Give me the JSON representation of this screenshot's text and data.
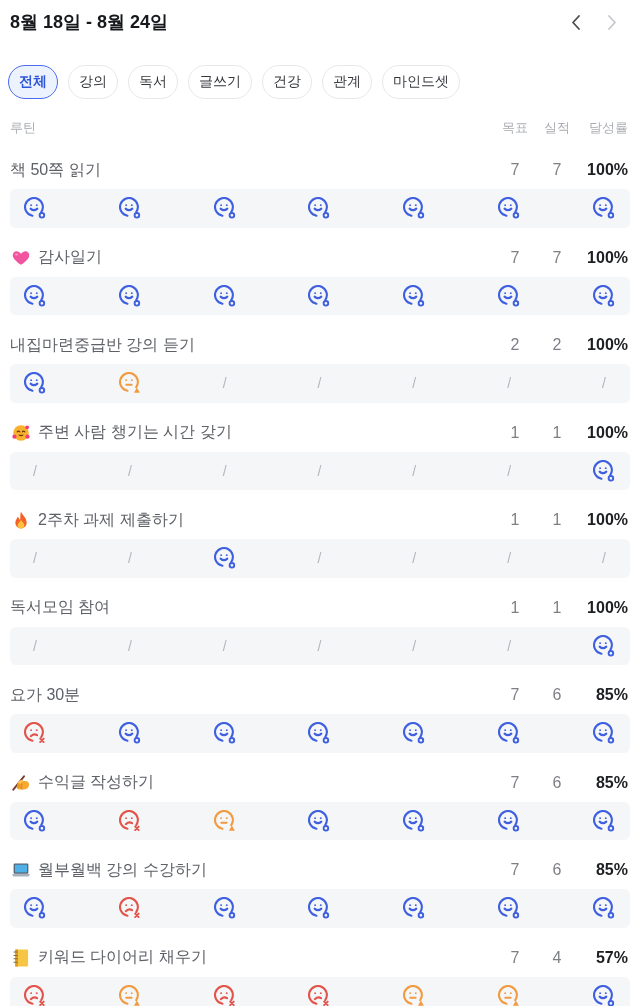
{
  "header": {
    "title": "8월 18일 - 8월 24일",
    "nav": [
      {
        "kind": "previous",
        "disabled": false
      },
      {
        "kind": "next",
        "disabled": true
      }
    ]
  },
  "tabs": [
    {
      "label": "전체",
      "selected": true
    },
    {
      "label": "강의",
      "selected": false
    },
    {
      "label": "독서",
      "selected": false
    },
    {
      "label": "글쓰기",
      "selected": false
    },
    {
      "label": "건강",
      "selected": false
    },
    {
      "label": "관계",
      "selected": false
    },
    {
      "label": "마인드셋",
      "selected": false
    }
  ],
  "columns": {
    "routine": "루틴",
    "goal": "목표",
    "actual": "실적",
    "rate": "달성률"
  },
  "routines": [
    {
      "kind": "plain",
      "title": "책 50쪽 읽기",
      "goal": "7",
      "actual": "7",
      "rate": "100%",
      "days": [
        {
          "kind": "done"
        },
        {
          "kind": "done"
        },
        {
          "kind": "done"
        },
        {
          "kind": "done"
        },
        {
          "kind": "done"
        },
        {
          "kind": "done"
        },
        {
          "kind": "done"
        }
      ]
    },
    {
      "kind": "heart",
      "title": "감사일기",
      "goal": "7",
      "actual": "7",
      "rate": "100%",
      "days": [
        {
          "kind": "done"
        },
        {
          "kind": "done"
        },
        {
          "kind": "done"
        },
        {
          "kind": "done"
        },
        {
          "kind": "done"
        },
        {
          "kind": "done"
        },
        {
          "kind": "done"
        }
      ]
    },
    {
      "kind": "plain",
      "title": "내집마련중급반 강의 듣기",
      "goal": "2",
      "actual": "2",
      "rate": "100%",
      "days": [
        {
          "kind": "done"
        },
        {
          "kind": "partial"
        },
        {
          "kind": "none",
          "text": "/"
        },
        {
          "kind": "none",
          "text": "/"
        },
        {
          "kind": "none",
          "text": "/"
        },
        {
          "kind": "none",
          "text": "/"
        },
        {
          "kind": "none",
          "text": "/"
        }
      ]
    },
    {
      "kind": "hearts-face",
      "title": "주변 사람 챙기는 시간 갖기",
      "goal": "1",
      "actual": "1",
      "rate": "100%",
      "days": [
        {
          "kind": "none",
          "text": "/"
        },
        {
          "kind": "none",
          "text": "/"
        },
        {
          "kind": "none",
          "text": "/"
        },
        {
          "kind": "none",
          "text": "/"
        },
        {
          "kind": "none",
          "text": "/"
        },
        {
          "kind": "none",
          "text": "/"
        },
        {
          "kind": "done"
        }
      ]
    },
    {
      "kind": "fire",
      "title": "2주차 과제 제출하기",
      "goal": "1",
      "actual": "1",
      "rate": "100%",
      "days": [
        {
          "kind": "none",
          "text": "/"
        },
        {
          "kind": "none",
          "text": "/"
        },
        {
          "kind": "done"
        },
        {
          "kind": "none",
          "text": "/"
        },
        {
          "kind": "none",
          "text": "/"
        },
        {
          "kind": "none",
          "text": "/"
        },
        {
          "kind": "none",
          "text": "/"
        }
      ]
    },
    {
      "kind": "plain",
      "title": "독서모임 참여",
      "goal": "1",
      "actual": "1",
      "rate": "100%",
      "days": [
        {
          "kind": "none",
          "text": "/"
        },
        {
          "kind": "none",
          "text": "/"
        },
        {
          "kind": "none",
          "text": "/"
        },
        {
          "kind": "none",
          "text": "/"
        },
        {
          "kind": "none",
          "text": "/"
        },
        {
          "kind": "none",
          "text": "/"
        },
        {
          "kind": "done"
        }
      ]
    },
    {
      "kind": "plain",
      "title": "요가 30분",
      "goal": "7",
      "actual": "6",
      "rate": "85%",
      "days": [
        {
          "kind": "fail"
        },
        {
          "kind": "done"
        },
        {
          "kind": "done"
        },
        {
          "kind": "done"
        },
        {
          "kind": "done"
        },
        {
          "kind": "done"
        },
        {
          "kind": "done"
        }
      ]
    },
    {
      "kind": "writing",
      "title": "수익글 작성하기",
      "goal": "7",
      "actual": "6",
      "rate": "85%",
      "days": [
        {
          "kind": "done"
        },
        {
          "kind": "fail"
        },
        {
          "kind": "partial"
        },
        {
          "kind": "done"
        },
        {
          "kind": "done"
        },
        {
          "kind": "done"
        },
        {
          "kind": "done"
        }
      ]
    },
    {
      "kind": "laptop",
      "title": "월부월백 강의 수강하기",
      "goal": "7",
      "actual": "6",
      "rate": "85%",
      "days": [
        {
          "kind": "done"
        },
        {
          "kind": "fail"
        },
        {
          "kind": "done"
        },
        {
          "kind": "done"
        },
        {
          "kind": "done"
        },
        {
          "kind": "done"
        },
        {
          "kind": "done"
        }
      ]
    },
    {
      "kind": "notebook",
      "title": "키워드 다이어리 채우기",
      "goal": "7",
      "actual": "4",
      "rate": "57%",
      "days": [
        {
          "kind": "fail"
        },
        {
          "kind": "partial"
        },
        {
          "kind": "fail"
        },
        {
          "kind": "fail"
        },
        {
          "kind": "partial"
        },
        {
          "kind": "partial"
        },
        {
          "kind": "done"
        }
      ]
    }
  ]
}
